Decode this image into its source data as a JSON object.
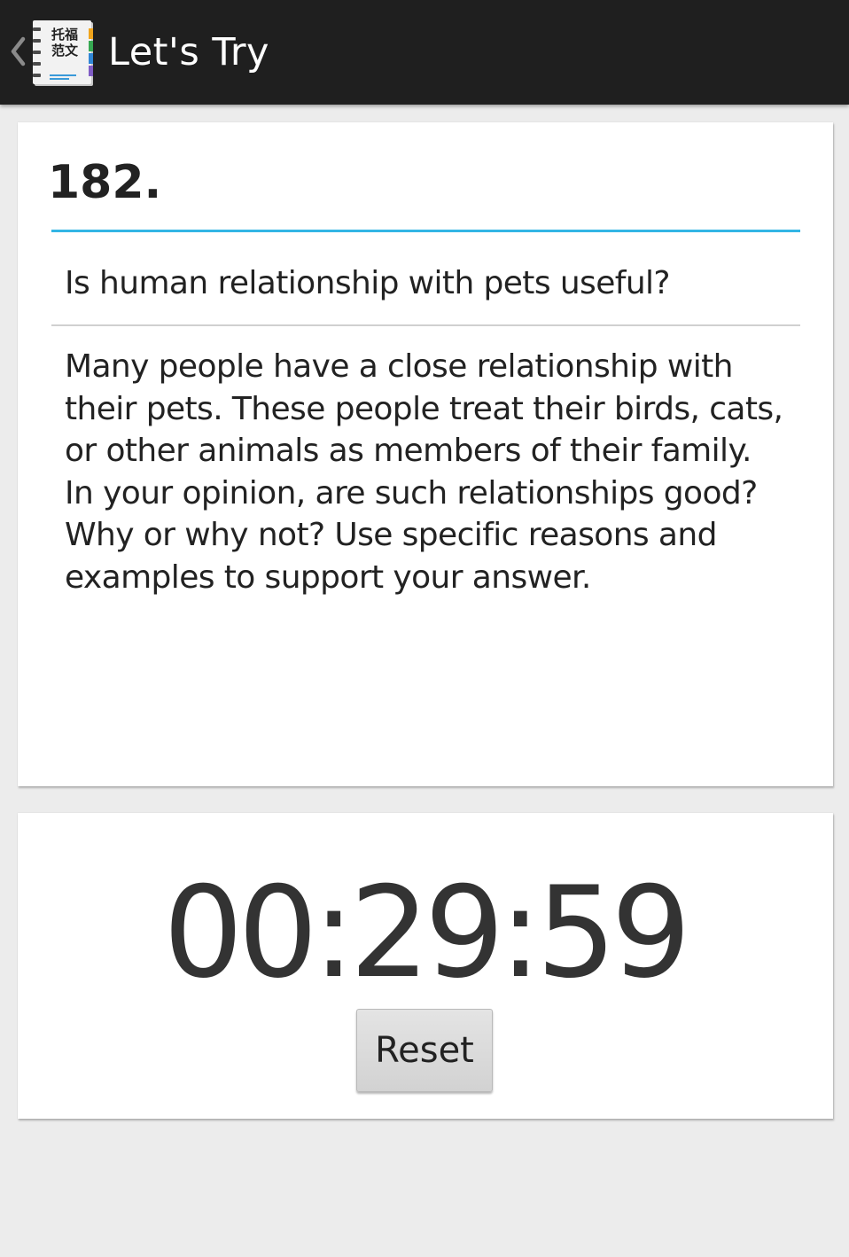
{
  "action_bar": {
    "title": "Let's Try",
    "app_icon_text_line1": "托福",
    "app_icon_text_line2": "范文",
    "background_color": "#1f1f1f"
  },
  "topic": {
    "number": "182.",
    "question": "Is human relationship with pets useful?",
    "prompt": "Many people have a close relationship with\ntheir pets. These people treat their birds, cats,\nor other animals as members of their family.\nIn your opinion, are such relationships good?\nWhy or why not? Use specific reasons and\nexamples to support your answer.",
    "accent_color": "#33b5e5"
  },
  "timer": {
    "display": "00:29:59",
    "reset_label": "Reset"
  }
}
